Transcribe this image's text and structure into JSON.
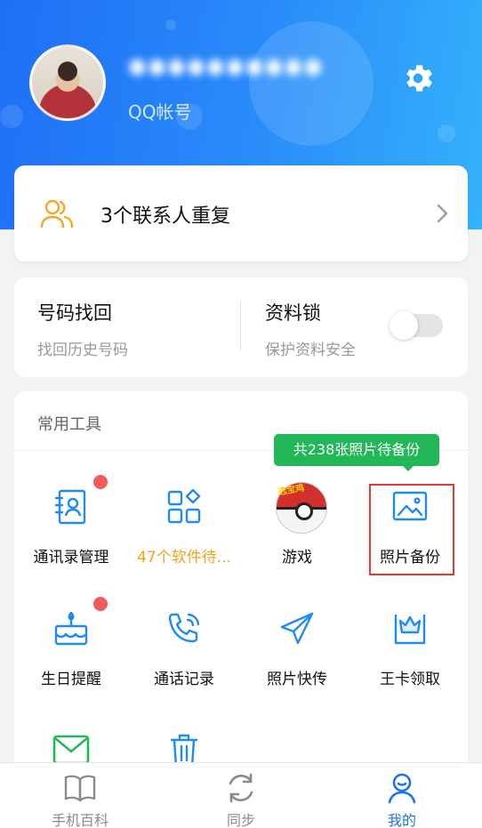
{
  "header": {
    "username": "●●●●●●●●●●",
    "account_label": "QQ帐号"
  },
  "duplicate_contacts": {
    "text": "3个联系人重复"
  },
  "features": {
    "recover": {
      "title": "号码找回",
      "subtitle": "找回历史号码"
    },
    "lock": {
      "title": "资料锁",
      "subtitle": "保护资料安全",
      "enabled": false
    }
  },
  "tools": {
    "title": "常用工具",
    "tooltip": "共238张照片待备份",
    "items": [
      {
        "label": "通讯录管理",
        "icon": "contacts-icon",
        "badge": true
      },
      {
        "label": "47个软件待...",
        "icon": "apps-icon",
        "badge": false
      },
      {
        "label": "游戏",
        "icon": "game-icon",
        "badge": false,
        "tag": "选宝鸡"
      },
      {
        "label": "照片备份",
        "icon": "photo-icon",
        "badge": false
      },
      {
        "label": "生日提醒",
        "icon": "cake-icon",
        "badge": true
      },
      {
        "label": "通话记录",
        "icon": "phone-icon",
        "badge": false
      },
      {
        "label": "照片快传",
        "icon": "send-icon",
        "badge": false
      },
      {
        "label": "王卡领取",
        "icon": "crown-card-icon",
        "badge": false
      },
      {
        "label": "",
        "icon": "mail-icon",
        "badge": false
      },
      {
        "label": "",
        "icon": "trash-icon",
        "badge": false
      }
    ]
  },
  "tabbar": {
    "items": [
      {
        "label": "手机百科",
        "icon": "book-icon",
        "active": false
      },
      {
        "label": "同步",
        "icon": "sync-icon",
        "active": false
      },
      {
        "label": "我的",
        "icon": "profile-icon",
        "active": true
      }
    ]
  },
  "colors": {
    "brand_blue": "#1e6ff5",
    "accent_orange": "#f6a21a",
    "tooltip_green": "#22b85a",
    "badge_red": "#f15b5b",
    "icon_blue": "#1f8cf0"
  }
}
